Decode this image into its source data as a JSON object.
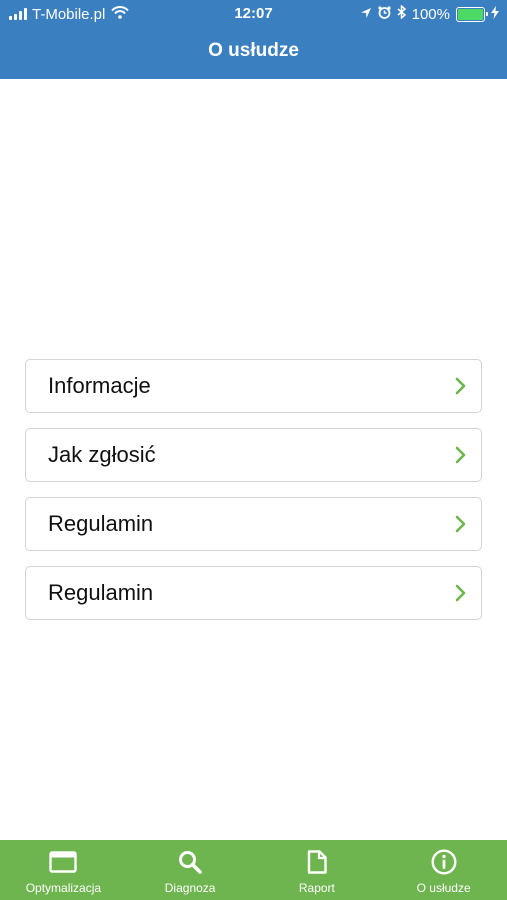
{
  "status_bar": {
    "carrier": "T-Mobile.pl",
    "time": "12:07",
    "battery": "100%",
    "battery_level": 1.0,
    "battery_color": "#4cd964",
    "icons": [
      "signal-icon",
      "wifi-icon",
      "location-icon",
      "alarm-icon",
      "bluetooth-icon",
      "battery-icon",
      "charging-icon"
    ]
  },
  "header": {
    "title": "O usłudze",
    "background": "#3a7fc0"
  },
  "menu": {
    "items": [
      {
        "label": "Informacje",
        "icon": "chevron-right-icon"
      },
      {
        "label": "Jak zgłosić",
        "icon": "chevron-right-icon"
      },
      {
        "label": "Regulamin",
        "icon": "chevron-right-icon"
      },
      {
        "label": "Regulamin",
        "icon": "chevron-right-icon"
      }
    ],
    "chevron_color": "#6fb54f"
  },
  "tabbar": {
    "background": "#6fb54f",
    "tabs": [
      {
        "label": "Optymalizacja",
        "icon": "window-icon"
      },
      {
        "label": "Diagnoza",
        "icon": "search-icon"
      },
      {
        "label": "Raport",
        "icon": "document-icon"
      },
      {
        "label": "O usłudze",
        "icon": "info-icon"
      }
    ]
  }
}
